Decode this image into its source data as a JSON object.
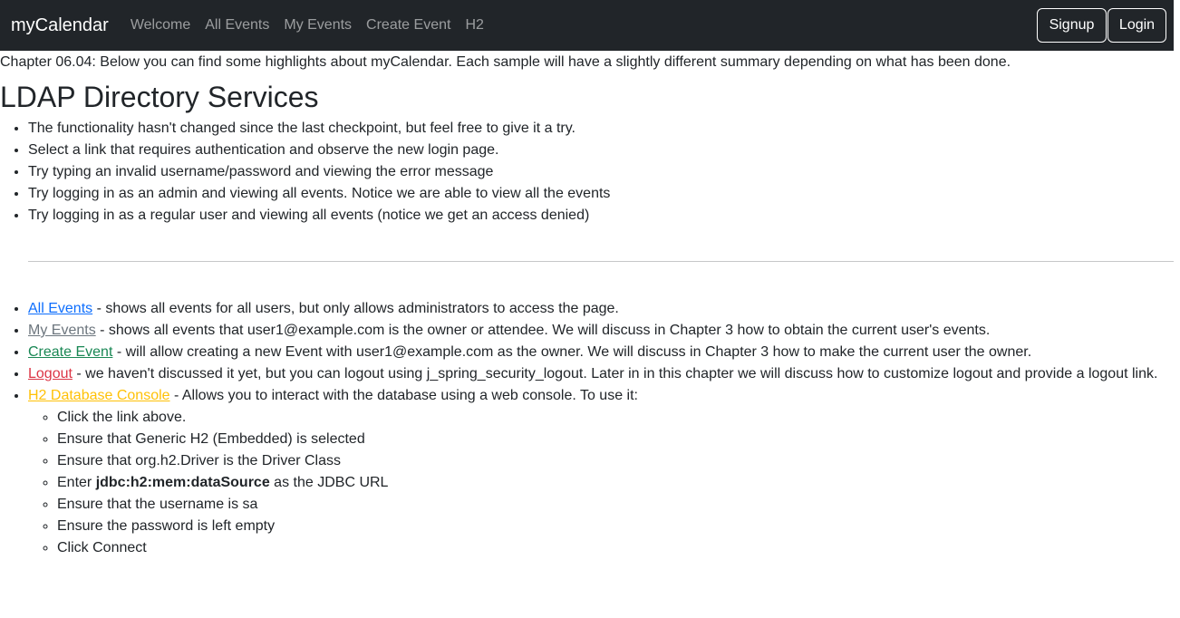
{
  "navbar": {
    "brand": "myCalendar",
    "links": [
      "Welcome",
      "All Events",
      "My Events",
      "Create Event",
      "H2"
    ],
    "signup": "Signup",
    "login": "Login"
  },
  "intro": "Chapter 06.04: Below you can find some highlights about myCalendar. Each sample will have a slightly different summary depending on what has been done.",
  "heading": "LDAP Directory Services",
  "highlights": [
    "The functionality hasn't changed since the last checkpoint, but feel free to give it a try.",
    "Select a link that requires authentication and observe the new login page.",
    "Try typing an invalid username/password and viewing the error message",
    "Try logging in as an admin and viewing all events. Notice we are able to view all the events",
    "Try logging in as a regular user and viewing all events (notice we get an access denied)"
  ],
  "links": {
    "all_events": {
      "label": "All Events",
      "desc": " - shows all events for all users, but only allows administrators to access the page."
    },
    "my_events": {
      "label": "My Events",
      "desc": " - shows all events that user1@example.com is the owner or attendee. We will discuss in Chapter 3 how to obtain the current user's events."
    },
    "create_event": {
      "label": "Create Event",
      "desc": " - will allow creating a new Event with user1@example.com as the owner. We will discuss in Chapter 3 how to make the current user the owner."
    },
    "logout": {
      "label": "Logout",
      "desc": " - we haven't discussed it yet, but you can logout using j_spring_security_logout. Later in in this chapter we will discuss how to customize logout and provide a logout link."
    },
    "h2": {
      "label": "H2 Database Console",
      "desc": " - Allows you to interact with the database using a web console. To use it:"
    }
  },
  "h2_steps": {
    "step1": "Click the link above.",
    "step2": "Ensure that Generic H2 (Embedded) is selected",
    "step3": "Ensure that org.h2.Driver is the Driver Class",
    "step4_prefix": "Enter ",
    "step4_bold": "jdbc:h2:mem:dataSource",
    "step4_suffix": " as the JDBC URL",
    "step5": "Ensure that the username is sa",
    "step6": "Ensure the password is left empty",
    "step7": "Click Connect"
  }
}
